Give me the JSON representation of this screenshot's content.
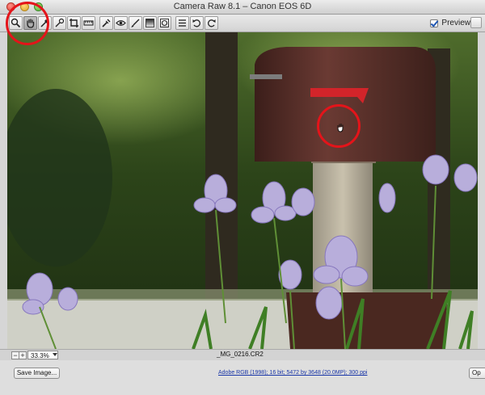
{
  "window": {
    "title": "Camera Raw 8.1  –  Canon EOS 6D"
  },
  "toolbar": {
    "tools": [
      "zoom-icon",
      "hand-icon",
      "white-balance-icon",
      "color-sampler-icon",
      "crop-icon",
      "straighten-icon",
      "spot-removal-icon",
      "red-eye-icon",
      "adjustment-brush-icon",
      "graduated-filter-icon",
      "radial-filter-icon",
      "preferences-icon",
      "rotate-left-icon",
      "rotate-right-icon"
    ],
    "active_tool": "hand-icon",
    "preview_label": "Preview",
    "preview_checked": true
  },
  "status": {
    "zoom_level": "33.3%",
    "filename": "_MG_0216.CR2"
  },
  "bottom": {
    "save_label": "Save Image...",
    "workflow_options": "Adobe RGB (1998); 16 bit; 5472 by 3648 (20.0MP); 300 ppi",
    "open_label": "Op"
  },
  "colors": {
    "annotation": "#e4141a",
    "link": "#1a37a8"
  }
}
